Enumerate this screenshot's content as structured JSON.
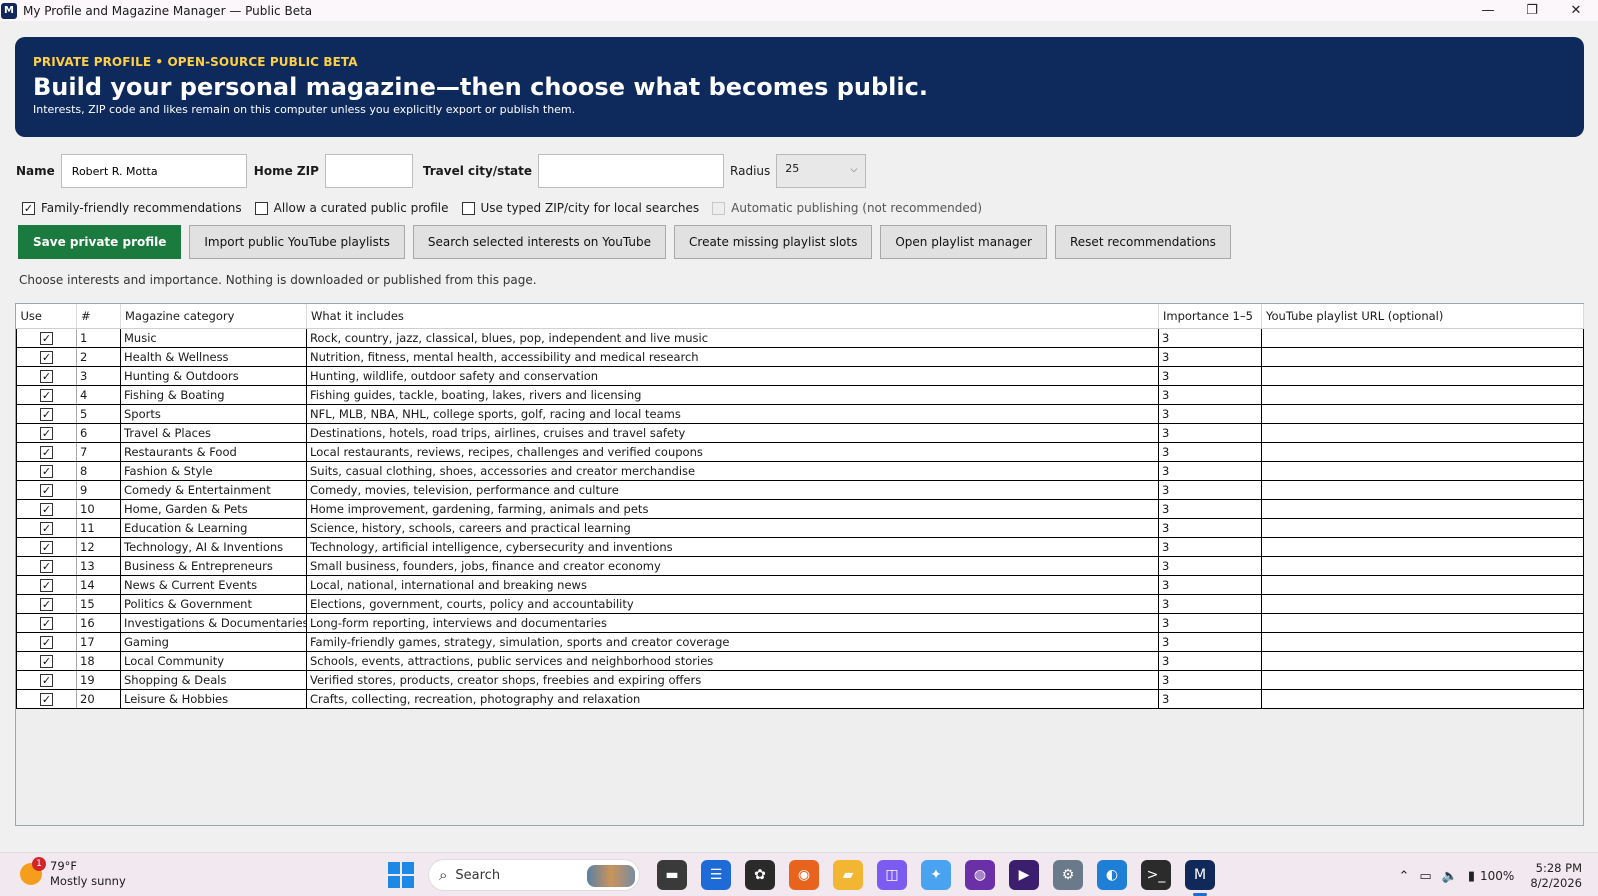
{
  "window": {
    "title": "My Profile and Magazine Manager — Public Beta"
  },
  "banner": {
    "eyebrow": "PRIVATE PROFILE • OPEN-SOURCE PUBLIC BETA",
    "headline": "Build your personal magazine—then choose what becomes public.",
    "sub": "Interests, ZIP code and likes remain on this computer unless you explicitly export or publish them."
  },
  "form": {
    "name_label": "Name",
    "name_value": "Robert R. Motta",
    "zip_label": "Home ZIP",
    "zip_value": "",
    "travel_label": "Travel city/state",
    "travel_value": "",
    "radius_label": "Radius",
    "radius_value": "25"
  },
  "options": [
    {
      "label": "Family-friendly recommendations",
      "checked": true,
      "disabled": false
    },
    {
      "label": "Allow a curated public profile",
      "checked": false,
      "disabled": false
    },
    {
      "label": "Use typed ZIP/city for local searches",
      "checked": false,
      "disabled": false
    },
    {
      "label": "Automatic publishing (not recommended)",
      "checked": false,
      "disabled": true
    }
  ],
  "buttons": {
    "save": "Save private profile",
    "import": "Import public YouTube playlists",
    "search": "Search selected interests on YouTube",
    "create": "Create missing playlist slots",
    "open": "Open playlist manager",
    "reset": "Reset recommendations"
  },
  "hint": "Choose interests and importance. Nothing is downloaded or published from this page.",
  "table": {
    "headers": [
      "Use",
      "#",
      "Magazine category",
      "What it includes",
      "Importance 1–5",
      "YouTube playlist URL (optional)"
    ],
    "rows": [
      {
        "use": true,
        "num": "1",
        "category": "Music",
        "includes": "Rock, country, jazz, classical, blues, pop, independent and live music",
        "importance": "3",
        "url": ""
      },
      {
        "use": true,
        "num": "2",
        "category": "Health & Wellness",
        "includes": "Nutrition, fitness, mental health, accessibility and medical research",
        "importance": "3",
        "url": ""
      },
      {
        "use": true,
        "num": "3",
        "category": "Hunting & Outdoors",
        "includes": "Hunting, wildlife, outdoor safety and conservation",
        "importance": "3",
        "url": ""
      },
      {
        "use": true,
        "num": "4",
        "category": "Fishing & Boating",
        "includes": "Fishing guides, tackle, boating, lakes, rivers and licensing",
        "importance": "3",
        "url": ""
      },
      {
        "use": true,
        "num": "5",
        "category": "Sports",
        "includes": "NFL, MLB, NBA, NHL, college sports, golf, racing and local teams",
        "importance": "3",
        "url": ""
      },
      {
        "use": true,
        "num": "6",
        "category": "Travel & Places",
        "includes": "Destinations, hotels, road trips, airlines, cruises and travel safety",
        "importance": "3",
        "url": ""
      },
      {
        "use": true,
        "num": "7",
        "category": "Restaurants & Food",
        "includes": "Local restaurants, reviews, recipes, challenges and verified coupons",
        "importance": "3",
        "url": ""
      },
      {
        "use": true,
        "num": "8",
        "category": "Fashion & Style",
        "includes": "Suits, casual clothing, shoes, accessories and creator merchandise",
        "importance": "3",
        "url": ""
      },
      {
        "use": true,
        "num": "9",
        "category": "Comedy & Entertainment",
        "includes": "Comedy, movies, television, performance and culture",
        "importance": "3",
        "url": ""
      },
      {
        "use": true,
        "num": "10",
        "category": "Home, Garden & Pets",
        "includes": "Home improvement, gardening, farming, animals and pets",
        "importance": "3",
        "url": ""
      },
      {
        "use": true,
        "num": "11",
        "category": "Education & Learning",
        "includes": "Science, history, schools, careers and practical learning",
        "importance": "3",
        "url": ""
      },
      {
        "use": true,
        "num": "12",
        "category": "Technology, AI & Inventions",
        "includes": "Technology, artificial intelligence, cybersecurity and inventions",
        "importance": "3",
        "url": ""
      },
      {
        "use": true,
        "num": "13",
        "category": "Business & Entrepreneurs",
        "includes": "Small business, founders, jobs, finance and creator economy",
        "importance": "3",
        "url": ""
      },
      {
        "use": true,
        "num": "14",
        "category": "News & Current Events",
        "includes": "Local, national, international and breaking news",
        "importance": "3",
        "url": ""
      },
      {
        "use": true,
        "num": "15",
        "category": "Politics & Government",
        "includes": "Elections, government, courts, policy and accountability",
        "importance": "3",
        "url": ""
      },
      {
        "use": true,
        "num": "16",
        "category": "Investigations & Documentaries",
        "includes": "Long-form reporting, interviews and documentaries",
        "importance": "3",
        "url": ""
      },
      {
        "use": true,
        "num": "17",
        "category": "Gaming",
        "includes": "Family-friendly games, strategy, simulation, sports and creator coverage",
        "importance": "3",
        "url": ""
      },
      {
        "use": true,
        "num": "18",
        "category": "Local Community",
        "includes": "Schools, events, attractions, public services and neighborhood stories",
        "importance": "3",
        "url": ""
      },
      {
        "use": true,
        "num": "19",
        "category": "Shopping & Deals",
        "includes": "Verified stores, products, creator shops, freebies and expiring offers",
        "importance": "3",
        "url": ""
      },
      {
        "use": true,
        "num": "20",
        "category": "Leisure & Hobbies",
        "includes": "Crafts, collecting, recreation, photography and relaxation",
        "importance": "3",
        "url": ""
      }
    ]
  },
  "taskbar": {
    "weather_badge": "1",
    "temp": "79°F",
    "condition": "Mostly sunny",
    "search_placeholder": "Search",
    "battery": "100%",
    "time": "5:28 PM",
    "date": "8/2/2026",
    "icons": [
      {
        "name": "file-explorer-dark-icon",
        "color": "#3a3a3a",
        "glyph": "▬"
      },
      {
        "name": "notepad-icon",
        "color": "#1e6ad6",
        "glyph": "☰"
      },
      {
        "name": "chatgpt-icon",
        "color": "#2a2a2a",
        "glyph": "✿"
      },
      {
        "name": "firefox-icon",
        "color": "#e8641e",
        "glyph": "◉"
      },
      {
        "name": "folder-icon",
        "color": "#f2b632",
        "glyph": "▰"
      },
      {
        "name": "app-launcher-icon",
        "color": "#7a5cf0",
        "glyph": "◫"
      },
      {
        "name": "copilot-icon",
        "color": "#4aa3f0",
        "glyph": "✦"
      },
      {
        "name": "game-app-icon",
        "color": "#6b2fa8",
        "glyph": "◍"
      },
      {
        "name": "media-player-icon",
        "color": "#3b1e6e",
        "glyph": "▶"
      },
      {
        "name": "settings-icon",
        "color": "#6a7a8a",
        "glyph": "⚙"
      },
      {
        "name": "browser-edge-icon",
        "color": "#1f7fd6",
        "glyph": "◐"
      },
      {
        "name": "terminal-icon",
        "color": "#2b2b2b",
        "glyph": ">_"
      },
      {
        "name": "magazine-manager-icon",
        "color": "#10285a",
        "glyph": "M"
      }
    ]
  },
  "colors": {
    "banner": "#0e2a5c",
    "eyebrow": "#ffd046",
    "primary_button": "#1b7a3d"
  }
}
